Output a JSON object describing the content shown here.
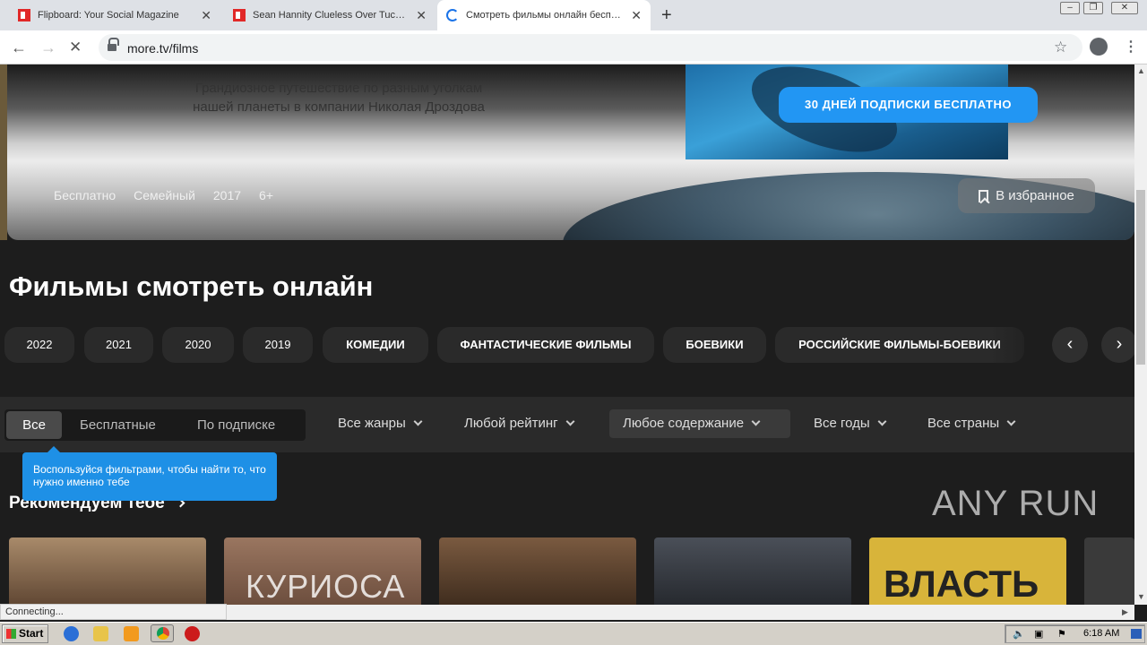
{
  "browser": {
    "tabs": [
      {
        "title": "Flipboard: Your Social Magazine",
        "close": "✕"
      },
      {
        "title": "Sean Hannity Clueless Over Tucker C",
        "close": "✕"
      },
      {
        "title": "Смотреть фильмы онлайн бесплат",
        "close": "✕"
      }
    ],
    "new_tab": "+",
    "url": "more.tv/films",
    "status": "Connecting..."
  },
  "hero": {
    "description_line1": "Грандиозное путешествие по разным уголкам",
    "description_line2": "нашей планеты в компании Николая Дроздова",
    "promo_button": "30 ДНЕЙ ПОДПИСКИ БЕСПЛАТНО",
    "meta": [
      "Бесплатно",
      "Семейный",
      "2017",
      "6+"
    ],
    "favorite_button": "В избранное"
  },
  "page_title": "Фильмы смотреть онлайн",
  "chips": [
    "2022",
    "2021",
    "2020",
    "2019",
    "КОМЕДИИ",
    "ФАНТАСТИЧЕСКИЕ ФИЛЬМЫ",
    "БОЕВИКИ",
    "РОССИЙСКИЕ ФИЛЬМЫ-БОЕВИКИ"
  ],
  "filters": {
    "segments": [
      "Все",
      "Бесплатные",
      "По подписке"
    ],
    "selected_segment": "Все",
    "dropdowns": [
      "Все жанры",
      "Любой рейтинг",
      "Любое содержание",
      "Все годы",
      "Все страны"
    ]
  },
  "tooltip": "Воспользуйся фильтрами, чтобы найти то, что нужно именно тебе",
  "section_title": "Рекомендуем тебе",
  "posters": [
    {
      "title": ""
    },
    {
      "title": "КУРИОСА"
    },
    {
      "title": ""
    },
    {
      "title": ""
    },
    {
      "title": "ВЛАСТЬ"
    }
  ],
  "watermark": "ANY RUN",
  "taskbar": {
    "start": "Start",
    "clock": "6:18 AM"
  },
  "colors": {
    "accent": "#2296f3",
    "page_bg": "#1d1d1d"
  }
}
